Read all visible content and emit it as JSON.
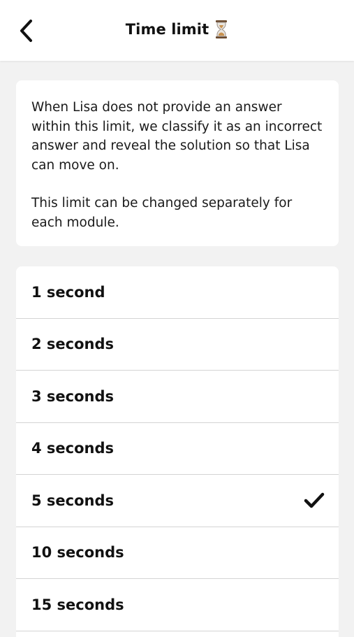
{
  "header": {
    "title": "Time limit",
    "title_icon": "hourglass-icon",
    "back_icon": "chevron-left-icon"
  },
  "info": {
    "paragraph1": "When Lisa does not provide an answer within this limit, we classify it as an incorrect answer and reveal the solution so that Lisa can move on.",
    "paragraph2": "This limit can be changed separately for each module."
  },
  "options": [
    {
      "label": "1 second",
      "selected": false
    },
    {
      "label": "2 seconds",
      "selected": false
    },
    {
      "label": "3 seconds",
      "selected": false
    },
    {
      "label": "4 seconds",
      "selected": false
    },
    {
      "label": "5 seconds",
      "selected": true
    },
    {
      "label": "10 seconds",
      "selected": false
    },
    {
      "label": "15 seconds",
      "selected": false
    }
  ],
  "colors": {
    "background": "#f2f2f2",
    "card": "#ffffff",
    "text": "#111111",
    "divider": "#d4d4d4"
  }
}
